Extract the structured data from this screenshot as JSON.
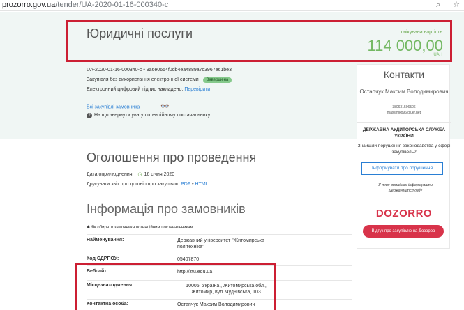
{
  "browser": {
    "url_domain": "prozorro.gov.ua",
    "url_path": "/tender/UA-2020-01-16-000340-c"
  },
  "tender": {
    "title": "Юридичні послуги",
    "value_label": "очікувана вартість",
    "value_amount": "114 000,00",
    "value_currency": "UAH",
    "id_line": "UA-2020-01-16-000340-c • 9a6e0654f0db4ea4889a7c3967e61be3",
    "procurement_type": "Закупівля без використання електронної системи",
    "status": "Завершена",
    "signature_text": "Електронний цифровий підпис накладено.",
    "signature_link": "Перевірити",
    "all_purchases_link": "Всі закупівлі замовника",
    "attention_text": "На що звернути увагу потенційному постачальнику"
  },
  "announcement": {
    "heading": "Оголошення про проведення",
    "pub_label": "Дата оприлюднення:",
    "pub_date": "16 січня 2020",
    "print_text": "Друкувати звіт про договір про закупівлю",
    "print_pdf": "PDF",
    "print_sep": "•",
    "print_html": "HTML"
  },
  "customer": {
    "heading": "Інформація про замовників",
    "howto": "Як обирати замовника потенційним постачальникам",
    "rows": [
      {
        "label": "Найменування:",
        "value": "Державний університет \"Житомирська політехніка\""
      },
      {
        "label": "Код ЄДРПОУ:",
        "value": "05407870"
      },
      {
        "label": "Вебсайт:",
        "value": "http://ztu.edu.ua"
      },
      {
        "label": "Місцезнаходження:",
        "value": "10005, Україна , Житомирська обл., Житомир, вул. Чуднівська, 103"
      },
      {
        "label": "Контактна особа:",
        "value": "Остапчук Максим Володимирович"
      }
    ]
  },
  "contacts": {
    "title": "Контакти",
    "name": "Остапчук Максим Володимирович",
    "phone": "380631506506",
    "email": "maxsimko96@ukr.net",
    "audit_title": "ДЕРЖАВНА АУДИТОРСЬКА СЛУЖБА УКРАЇНИ",
    "audit_text": "Знайшли порушення законодавства у сфері закупівель?",
    "inform_button": "Інформувати про порушення",
    "some_cases": "У яких випадках інформувати Держаудитслужбу",
    "dozorro_logo": "DOZORRO",
    "dozorro_button": "Відгук про закупівлю на Дозорро"
  },
  "colors": {
    "accent_red": "#cc1f33",
    "value_green": "#74b863",
    "link_blue": "#2a7fd4",
    "hero_bg": "#f0f6f4"
  }
}
